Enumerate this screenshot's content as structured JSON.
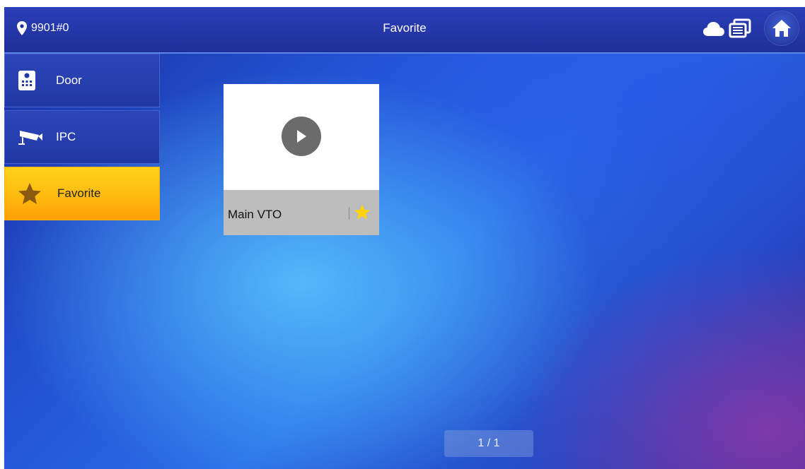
{
  "header": {
    "location_id": "9901#0",
    "title": "Favorite",
    "icons": [
      "location-pin-icon",
      "cloud-icon",
      "screens-icon",
      "home-icon"
    ]
  },
  "sidebar": {
    "items": [
      {
        "label": "Door",
        "icon": "door-station-icon",
        "active": false
      },
      {
        "label": "IPC",
        "icon": "camera-icon",
        "active": false
      },
      {
        "label": "Favorite",
        "icon": "star-icon",
        "active": true
      }
    ]
  },
  "favorites": [
    {
      "name": "Main VTO",
      "favorited": true
    }
  ],
  "pager": {
    "text": "1 / 1"
  },
  "colors": {
    "active_tab": "#ffbb10",
    "favorite_star": "#ffd400",
    "topbar": "#1f2f9a"
  }
}
